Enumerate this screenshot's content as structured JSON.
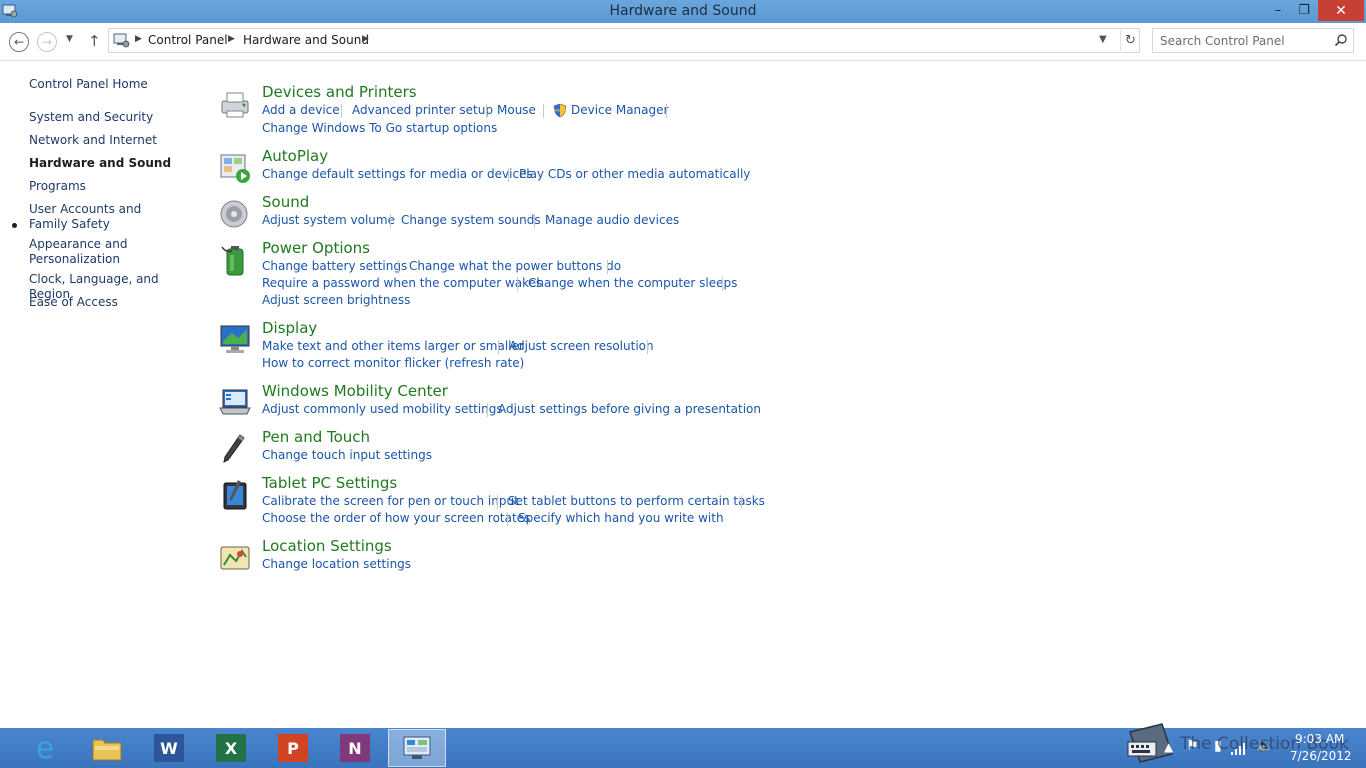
{
  "window": {
    "title": "Hardware and Sound",
    "minimize_glyph": "–",
    "maximize_glyph": "❐",
    "close_glyph": "✕"
  },
  "nav": {
    "breadcrumbs": [
      "Control Panel",
      "Hardware and Sound"
    ],
    "search_placeholder": "Search Control Panel"
  },
  "sidebar": {
    "items": [
      {
        "label": "Control Panel Home"
      },
      {
        "label": "System and Security"
      },
      {
        "label": "Network and Internet"
      },
      {
        "label": "Hardware and Sound",
        "current": true
      },
      {
        "label": "Programs"
      },
      {
        "label": "User Accounts and Family Safety"
      },
      {
        "label": "Appearance and Personalization"
      },
      {
        "label": "Clock, Language, and Region"
      },
      {
        "label": "Ease of Access"
      }
    ]
  },
  "categories": [
    {
      "title": "Devices and Printers",
      "icon": "printer-icon",
      "links": [
        "Add a device",
        "Advanced printer setup",
        "Mouse",
        "Device Manager",
        "Change Windows To Go startup options"
      ]
    },
    {
      "title": "AutoPlay",
      "icon": "autoplay-icon",
      "links": [
        "Change default settings for media or devices",
        "Play CDs or other media automatically"
      ]
    },
    {
      "title": "Sound",
      "icon": "speaker-icon",
      "links": [
        "Adjust system volume",
        "Change system sounds",
        "Manage audio devices"
      ]
    },
    {
      "title": "Power Options",
      "icon": "battery-icon",
      "links": [
        "Change battery settings",
        "Change what the power buttons do",
        "Require a password when the computer wakes",
        "Change when the computer sleeps",
        "Adjust screen brightness"
      ]
    },
    {
      "title": "Display",
      "icon": "monitor-icon",
      "links": [
        "Make text and other items larger or smaller",
        "Adjust screen resolution",
        "How to correct monitor flicker (refresh rate)"
      ]
    },
    {
      "title": "Windows Mobility Center",
      "icon": "laptop-icon",
      "links": [
        "Adjust commonly used mobility settings",
        "Adjust settings before giving a presentation"
      ]
    },
    {
      "title": "Pen and Touch",
      "icon": "pen-icon",
      "links": [
        "Change touch input settings"
      ]
    },
    {
      "title": "Tablet PC Settings",
      "icon": "tablet-icon",
      "links": [
        "Calibrate the screen for pen or touch input",
        "Set tablet buttons to perform certain tasks",
        "Choose the order of how your screen rotates",
        "Specify which hand you write with"
      ]
    },
    {
      "title": "Location Settings",
      "icon": "location-icon",
      "links": [
        "Change location settings"
      ]
    }
  ],
  "taskbar": {
    "apps": [
      {
        "name": "internet-explorer",
        "glyph": "e"
      },
      {
        "name": "file-explorer",
        "glyph": ""
      },
      {
        "name": "word",
        "glyph": "W"
      },
      {
        "name": "excel",
        "glyph": "X"
      },
      {
        "name": "powerpoint",
        "glyph": "P"
      },
      {
        "name": "onenote",
        "glyph": "N"
      },
      {
        "name": "control-panel",
        "glyph": "",
        "active": true
      }
    ],
    "watermark": "The Collection Book",
    "time": "9:03 AM",
    "date": "7/26/2012"
  },
  "colors": {
    "titlebar": "#5b99d3",
    "taskbar": "#3f7ac3",
    "link": "#1a55a8",
    "category_title": "#1f7a1f",
    "close_button": "#c74033"
  }
}
